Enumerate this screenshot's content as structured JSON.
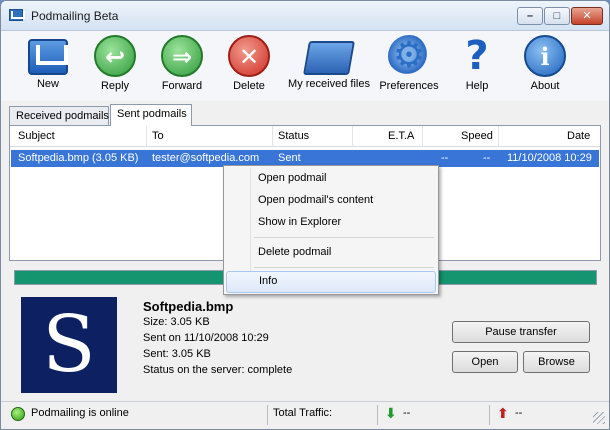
{
  "window": {
    "title": "Podmailing Beta"
  },
  "titlebar_buttons": {
    "minimize": "–",
    "maximize": "□",
    "close": "✕"
  },
  "toolbar": {
    "new": "New",
    "reply": "Reply",
    "forward": "Forward",
    "delete": "Delete",
    "received": "My received files",
    "preferences": "Preferences",
    "help": "Help",
    "about": "About"
  },
  "icons": {
    "reply_glyph": "↩",
    "forward_glyph": "⇒",
    "delete_glyph": "✕",
    "prefs_glyph": "⚙",
    "help_glyph": "?",
    "about_glyph": "i",
    "thumb_letter": "S"
  },
  "tabs": {
    "received": "Received podmails",
    "sent": "Sent podmails"
  },
  "list": {
    "columns": {
      "subject": "Subject",
      "to": "To",
      "status": "Status",
      "eta": "E.T.A",
      "speed": "Speed",
      "date": "Date"
    },
    "rows": [
      {
        "subject": "Softpedia.bmp (3.05 KB)",
        "to": "tester@softpedia.com",
        "status": "Sent",
        "eta": "--",
        "speed": "--",
        "date": "11/10/2008 10:29"
      }
    ]
  },
  "context_menu": {
    "items": [
      "Open podmail",
      "Open podmail's content",
      "Show in Explorer",
      "Delete podmail",
      "Info"
    ]
  },
  "progress": {
    "fraction": 1.0,
    "color": "#14956f"
  },
  "details": {
    "filename": "Softpedia.bmp",
    "size": "Size: 3.05 KB",
    "sent_on": "Sent on 11/10/2008 10:29",
    "sent": "Sent: 3.05 KB",
    "server_status": "Status on the server: complete",
    "pause_button": "Pause transfer",
    "open_button": "Open",
    "browse_button": "Browse"
  },
  "statusbar": {
    "online": "Podmailing is online",
    "traffic_label": "Total Traffic:",
    "down_value": "--",
    "up_value": "--",
    "down_arrow": "⬇",
    "up_arrow": "⬆"
  },
  "colors": {
    "selection": "#3875d7",
    "accent_green": "#14956f"
  }
}
